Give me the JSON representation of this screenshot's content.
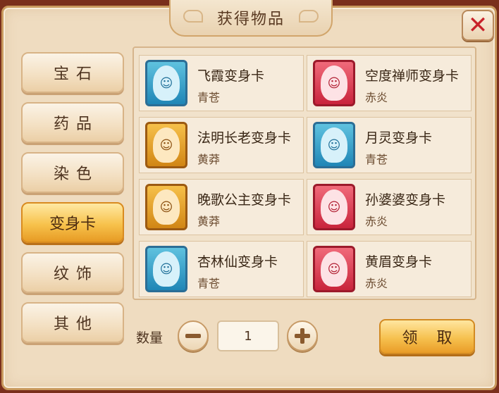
{
  "dialog": {
    "title": "获得物品"
  },
  "categories": [
    {
      "label": "宝石",
      "active": false
    },
    {
      "label": "药品",
      "active": false
    },
    {
      "label": "染色",
      "active": false
    },
    {
      "label": "变身卡",
      "active": true
    },
    {
      "label": "纹饰",
      "active": false
    },
    {
      "label": "其他",
      "active": false
    }
  ],
  "items": [
    {
      "name": "飞霞变身卡",
      "tag": "青苍",
      "icon": "blue-card-icon",
      "color": "#2b8fc0"
    },
    {
      "name": "空度禅师变身卡",
      "tag": "赤炎",
      "icon": "red-card-icon",
      "color": "#c9243c"
    },
    {
      "name": "法明长老变身卡",
      "tag": "黄莽",
      "icon": "gold-card-icon",
      "color": "#d18615"
    },
    {
      "name": "月灵变身卡",
      "tag": "青苍",
      "icon": "blue-card-icon",
      "color": "#2b8fc0"
    },
    {
      "name": "晚歌公主变身卡",
      "tag": "黄莽",
      "icon": "gold-card-icon",
      "color": "#d18615"
    },
    {
      "name": "孙婆婆变身卡",
      "tag": "赤炎",
      "icon": "red-card-icon",
      "color": "#c9243c"
    },
    {
      "name": "杏林仙变身卡",
      "tag": "青苍",
      "icon": "blue-card-icon",
      "color": "#2b8fc0"
    },
    {
      "name": "黄眉变身卡",
      "tag": "赤炎",
      "icon": "red-card-icon",
      "color": "#c9243c"
    }
  ],
  "quantity": {
    "label": "数量",
    "value": "1"
  },
  "claim_label": "领 取",
  "colors": {
    "active_tab": "#f6c14f",
    "panel": "#efdcc0",
    "close": "#c8222a"
  }
}
